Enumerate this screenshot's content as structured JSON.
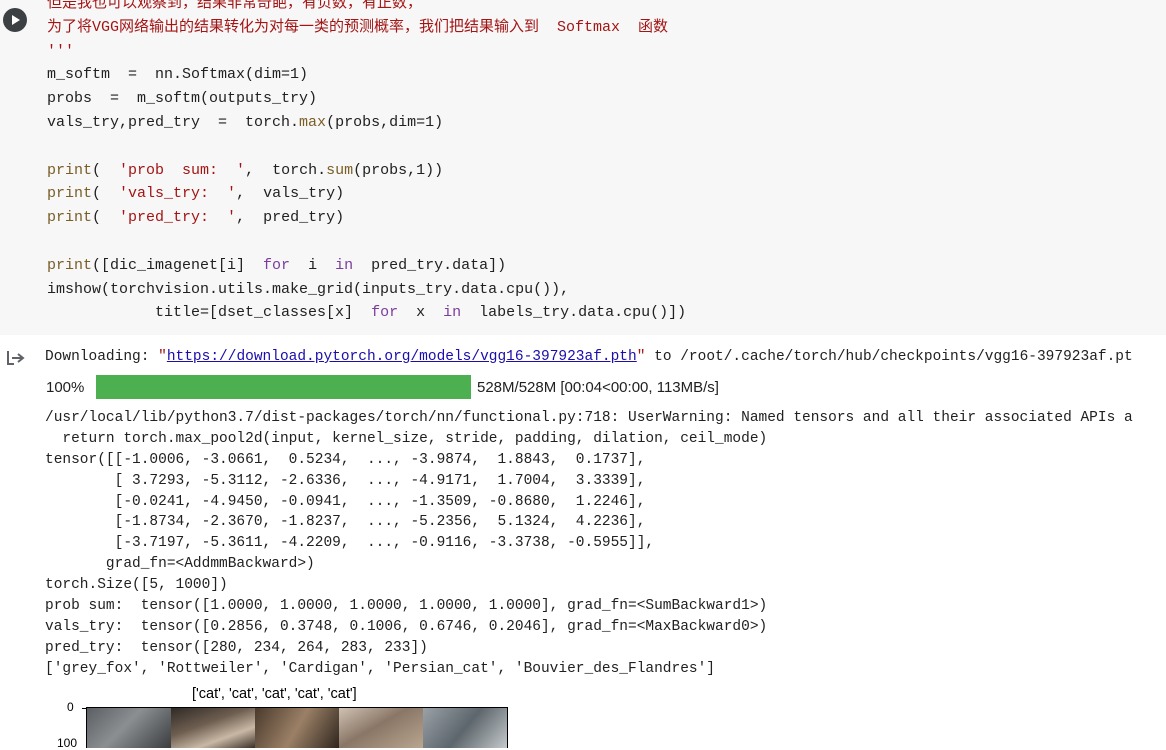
{
  "code_lines": [
    [
      {
        "t": "但是我也可以观察到，结果非常奇葩，有负数，有正数，",
        "c": "str"
      }
    ],
    [
      {
        "t": "为了将VGG网络输出的结果转化为对每一类的预测概率，我们把结果输入到  Softmax  函数",
        "c": "str"
      }
    ],
    [
      {
        "t": "'''",
        "c": "str"
      }
    ],
    [
      {
        "t": "m_softm  =  nn.Softmax(dim=1)",
        "c": ""
      }
    ],
    [
      {
        "t": "probs  =  m_softm(outputs_try)",
        "c": ""
      }
    ],
    [
      {
        "t": "vals_try,pred_try  =  torch.",
        "c": ""
      },
      {
        "t": "max",
        "c": "fn"
      },
      {
        "t": "(probs,dim=1)",
        "c": ""
      }
    ],
    [
      {
        "t": "",
        "c": ""
      }
    ],
    [
      {
        "t": "print",
        "c": "fn"
      },
      {
        "t": "(  ",
        "c": ""
      },
      {
        "t": "'prob  sum:  '",
        "c": "str"
      },
      {
        "t": ",  torch.",
        "c": ""
      },
      {
        "t": "sum",
        "c": "fn"
      },
      {
        "t": "(probs,1))",
        "c": ""
      }
    ],
    [
      {
        "t": "print",
        "c": "fn"
      },
      {
        "t": "(  ",
        "c": ""
      },
      {
        "t": "'vals_try:  '",
        "c": "str"
      },
      {
        "t": ",  vals_try)",
        "c": ""
      }
    ],
    [
      {
        "t": "print",
        "c": "fn"
      },
      {
        "t": "(  ",
        "c": ""
      },
      {
        "t": "'pred_try:  '",
        "c": "str"
      },
      {
        "t": ",  pred_try)",
        "c": ""
      }
    ],
    [
      {
        "t": "",
        "c": ""
      }
    ],
    [
      {
        "t": "print",
        "c": "fn"
      },
      {
        "t": "([dic_imagenet[i]  ",
        "c": ""
      },
      {
        "t": "for",
        "c": "kw"
      },
      {
        "t": "  i  ",
        "c": ""
      },
      {
        "t": "in",
        "c": "kw"
      },
      {
        "t": "  pred_try.data])",
        "c": ""
      }
    ],
    [
      {
        "t": "imshow(torchvision.utils.make_grid(inputs_try.data.cpu()),",
        "c": ""
      }
    ],
    [
      {
        "t": "            title=[dset_classes[x]  ",
        "c": ""
      },
      {
        "t": "for",
        "c": "kw"
      },
      {
        "t": "  x  ",
        "c": ""
      },
      {
        "t": "in",
        "c": "kw"
      },
      {
        "t": "  labels_try.data.cpu()])",
        "c": ""
      }
    ]
  ],
  "download": {
    "prefix": "Downloading: ",
    "quote_open": "\"",
    "url": "https://download.pytorch.org/models/vgg16-397923af.pth",
    "quote_close": "\"",
    "suffix": " to /root/.cache/torch/hub/checkpoints/vgg16-397923af.pt"
  },
  "progress": {
    "percent_label": "100%",
    "fraction": 1.0,
    "stats": "528M/528M [00:04<00:00, 113MB/s]",
    "bar_color": "#4caf50"
  },
  "log_lines": [
    "/usr/local/lib/python3.7/dist-packages/torch/nn/functional.py:718: UserWarning: Named tensors and all their associated APIs a",
    "  return torch.max_pool2d(input, kernel_size, stride, padding, dilation, ceil_mode)",
    "tensor([[-1.0006, -3.0661,  0.5234,  ..., -3.9874,  1.8843,  0.1737],",
    "        [ 3.7293, -5.3112, -2.6336,  ..., -4.9171,  1.7004,  3.3339],",
    "        [-0.0241, -4.9450, -0.0941,  ..., -1.3509, -0.8680,  1.2246],",
    "        [-1.8734, -2.3670, -1.8237,  ..., -5.2356,  5.1324,  4.2236],",
    "        [-3.7197, -5.3611, -4.2209,  ..., -0.9116, -3.3738, -0.5955]],",
    "       grad_fn=<AddmmBackward>)",
    "torch.Size([5, 1000])",
    "prob sum:  tensor([1.0000, 1.0000, 1.0000, 1.0000, 1.0000], grad_fn=<SumBackward1>)",
    "vals_try:  tensor([0.2856, 0.3748, 0.1006, 0.6746, 0.2046], grad_fn=<MaxBackward0>)",
    "pred_try:  tensor([280, 234, 264, 283, 233])",
    "['grey_fox', 'Rottweiler', 'Cardigan', 'Persian_cat', 'Bouvier_des_Flandres']"
  ],
  "plot": {
    "title": "['cat', 'cat', 'cat', 'cat', 'cat']",
    "ytick_0": "0",
    "ytick_1": "100"
  }
}
